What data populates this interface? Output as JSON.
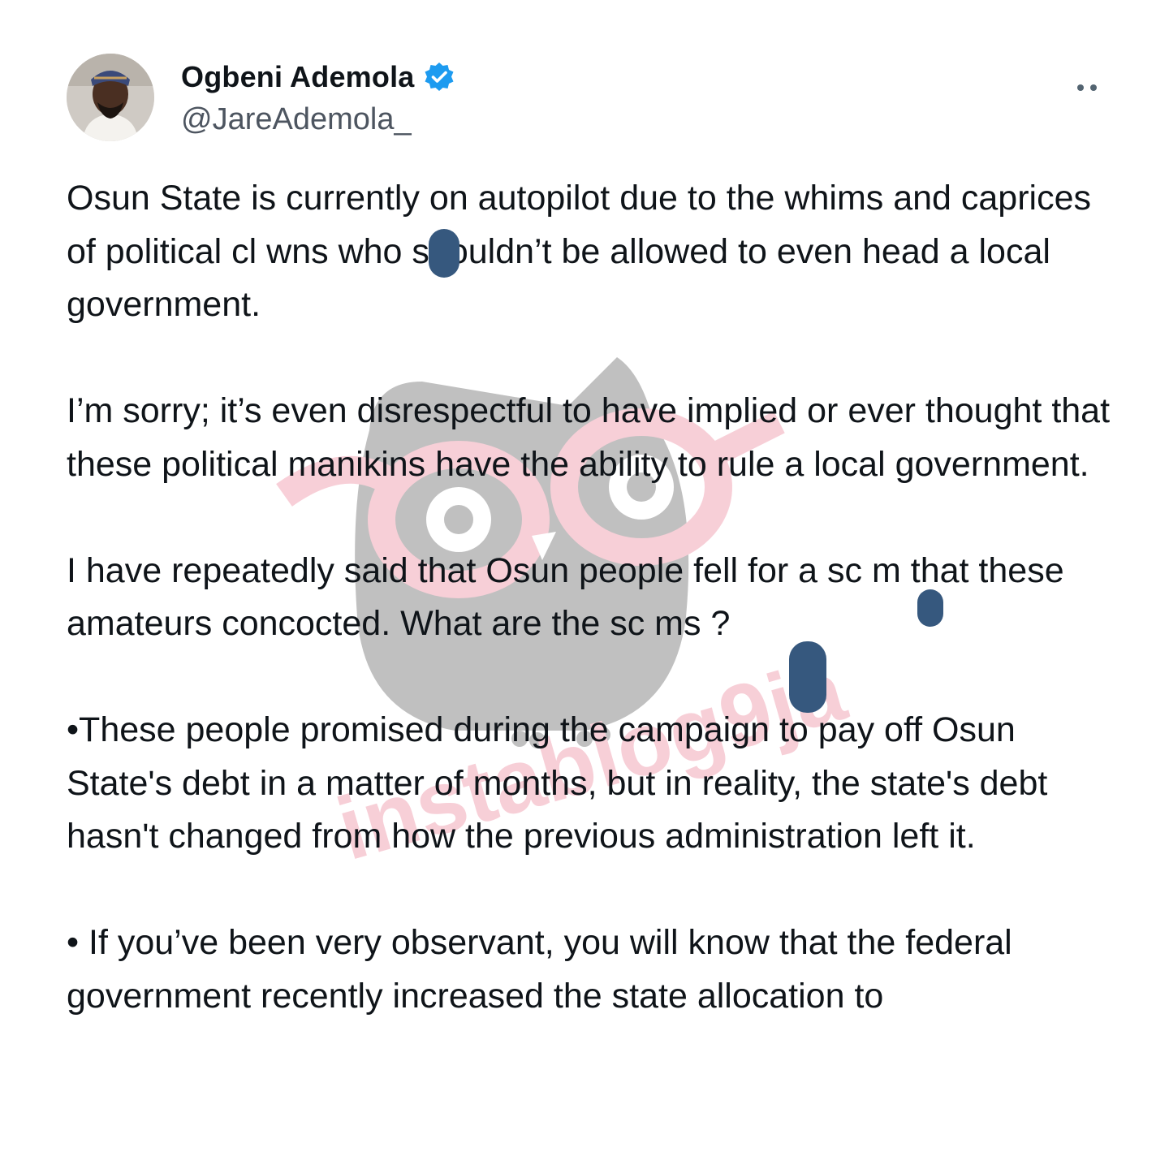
{
  "tweet": {
    "author": {
      "display_name": "Ogbeni Ademola",
      "handle": "@JareAdemola_",
      "verified": true,
      "verified_color": "#1d9bf0",
      "avatar_icon": "avatar-photo"
    },
    "more_icon": "more-dots-icon",
    "paragraphs": [
      "Osun State is currently on autopilot due to the whims and caprices of political cl  wns who shouldn’t be allowed to even head a local government.",
      "I’m sorry; it’s even disrespectful to have implied or ever thought that these political manikins have the ability to rule a local government.",
      "I have repeatedly said that Osun people fell for a sc  m that these amateurs concocted. What are the sc  ms ?",
      "•These people promised during the campaign to pay off Osun State's debt in a matter of months, but in reality, the state's debt hasn't changed from how the previous administration left it.",
      "• If you’ve been very observant, you will know that the federal government recently increased the state allocation to"
    ]
  },
  "watermark": {
    "text": "instablog9ja",
    "owl_color": "#8e8e8e",
    "glasses_color": "#f2a8b8"
  },
  "redaction_color": "#36587e"
}
